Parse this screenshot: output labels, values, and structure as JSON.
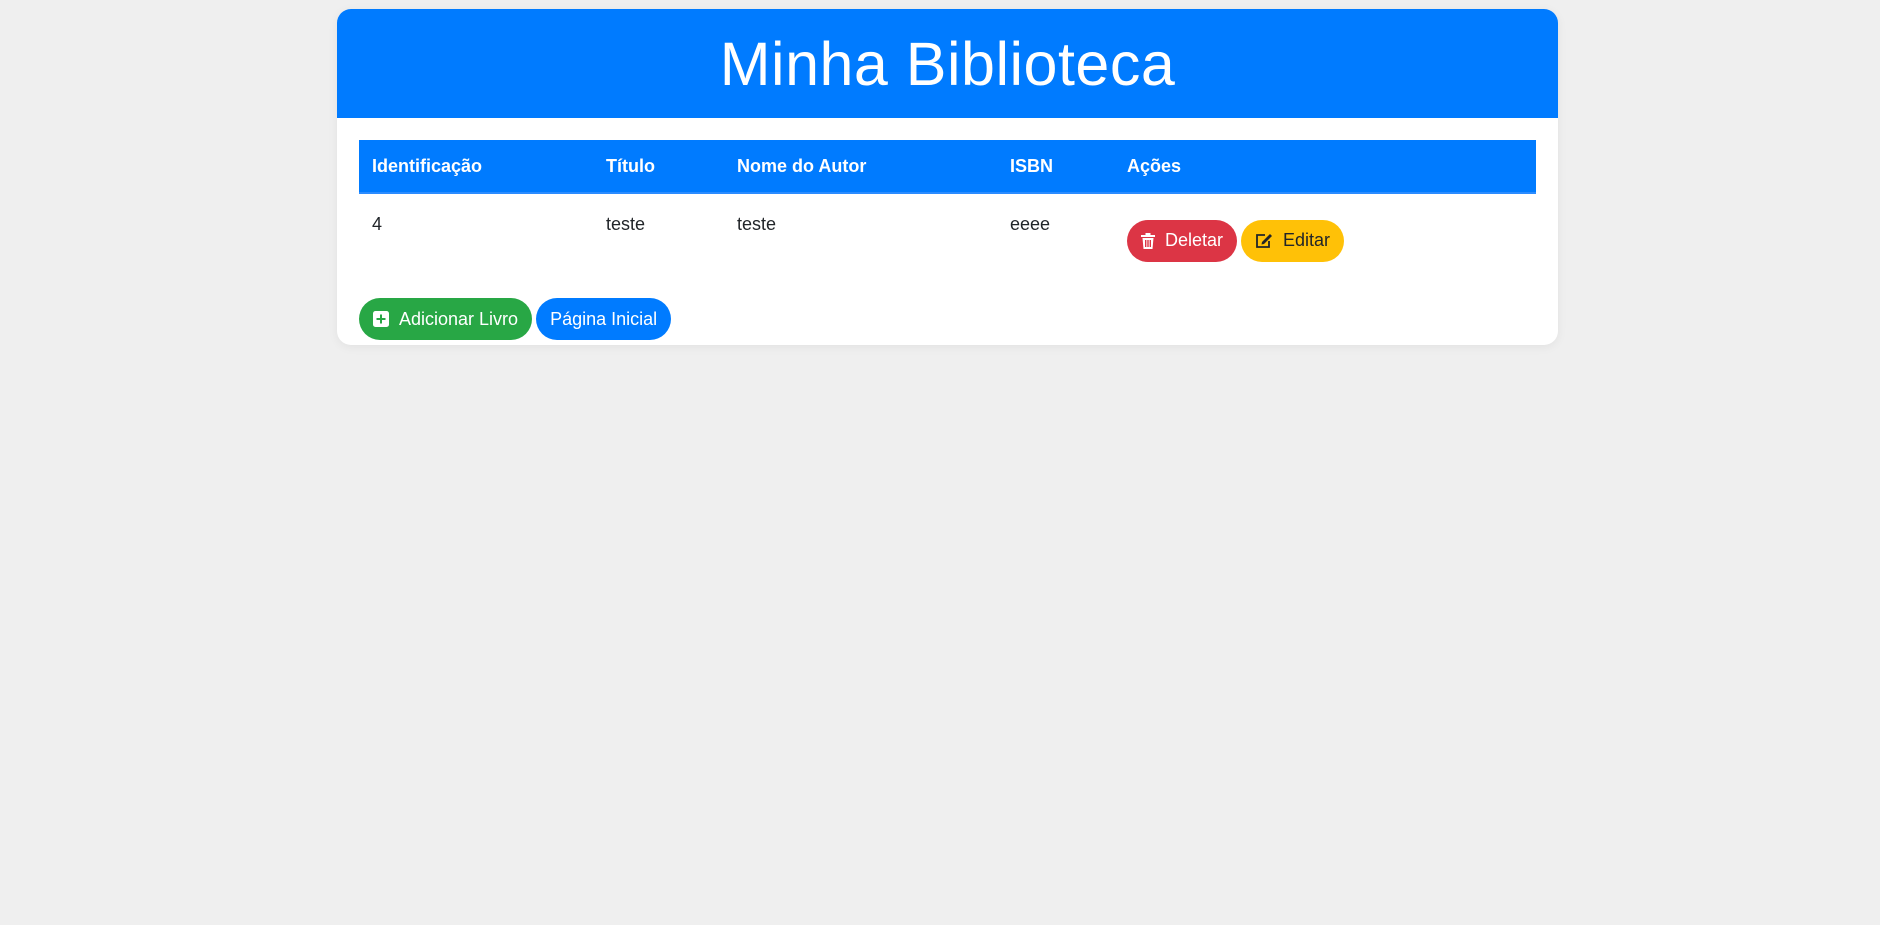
{
  "header": {
    "title": "Minha Biblioteca"
  },
  "table": {
    "columns": [
      "Identificação",
      "Título",
      "Nome do Autor",
      "ISBN",
      "Ações"
    ],
    "rows": [
      {
        "id": "4",
        "title": "teste",
        "author": "teste",
        "isbn": "eeee",
        "delete_label": "Deletar",
        "edit_label": "Editar"
      }
    ]
  },
  "footer_actions": {
    "add_label": "Adicionar Livro",
    "home_label": "Página Inicial"
  },
  "icons": {
    "delete": "trash-icon",
    "edit": "edit-icon",
    "add": "plus-square-icon"
  },
  "colors": {
    "primary": "#007bff",
    "danger": "#dc3545",
    "warning": "#ffc107",
    "success": "#28a745",
    "background": "#efefef"
  }
}
